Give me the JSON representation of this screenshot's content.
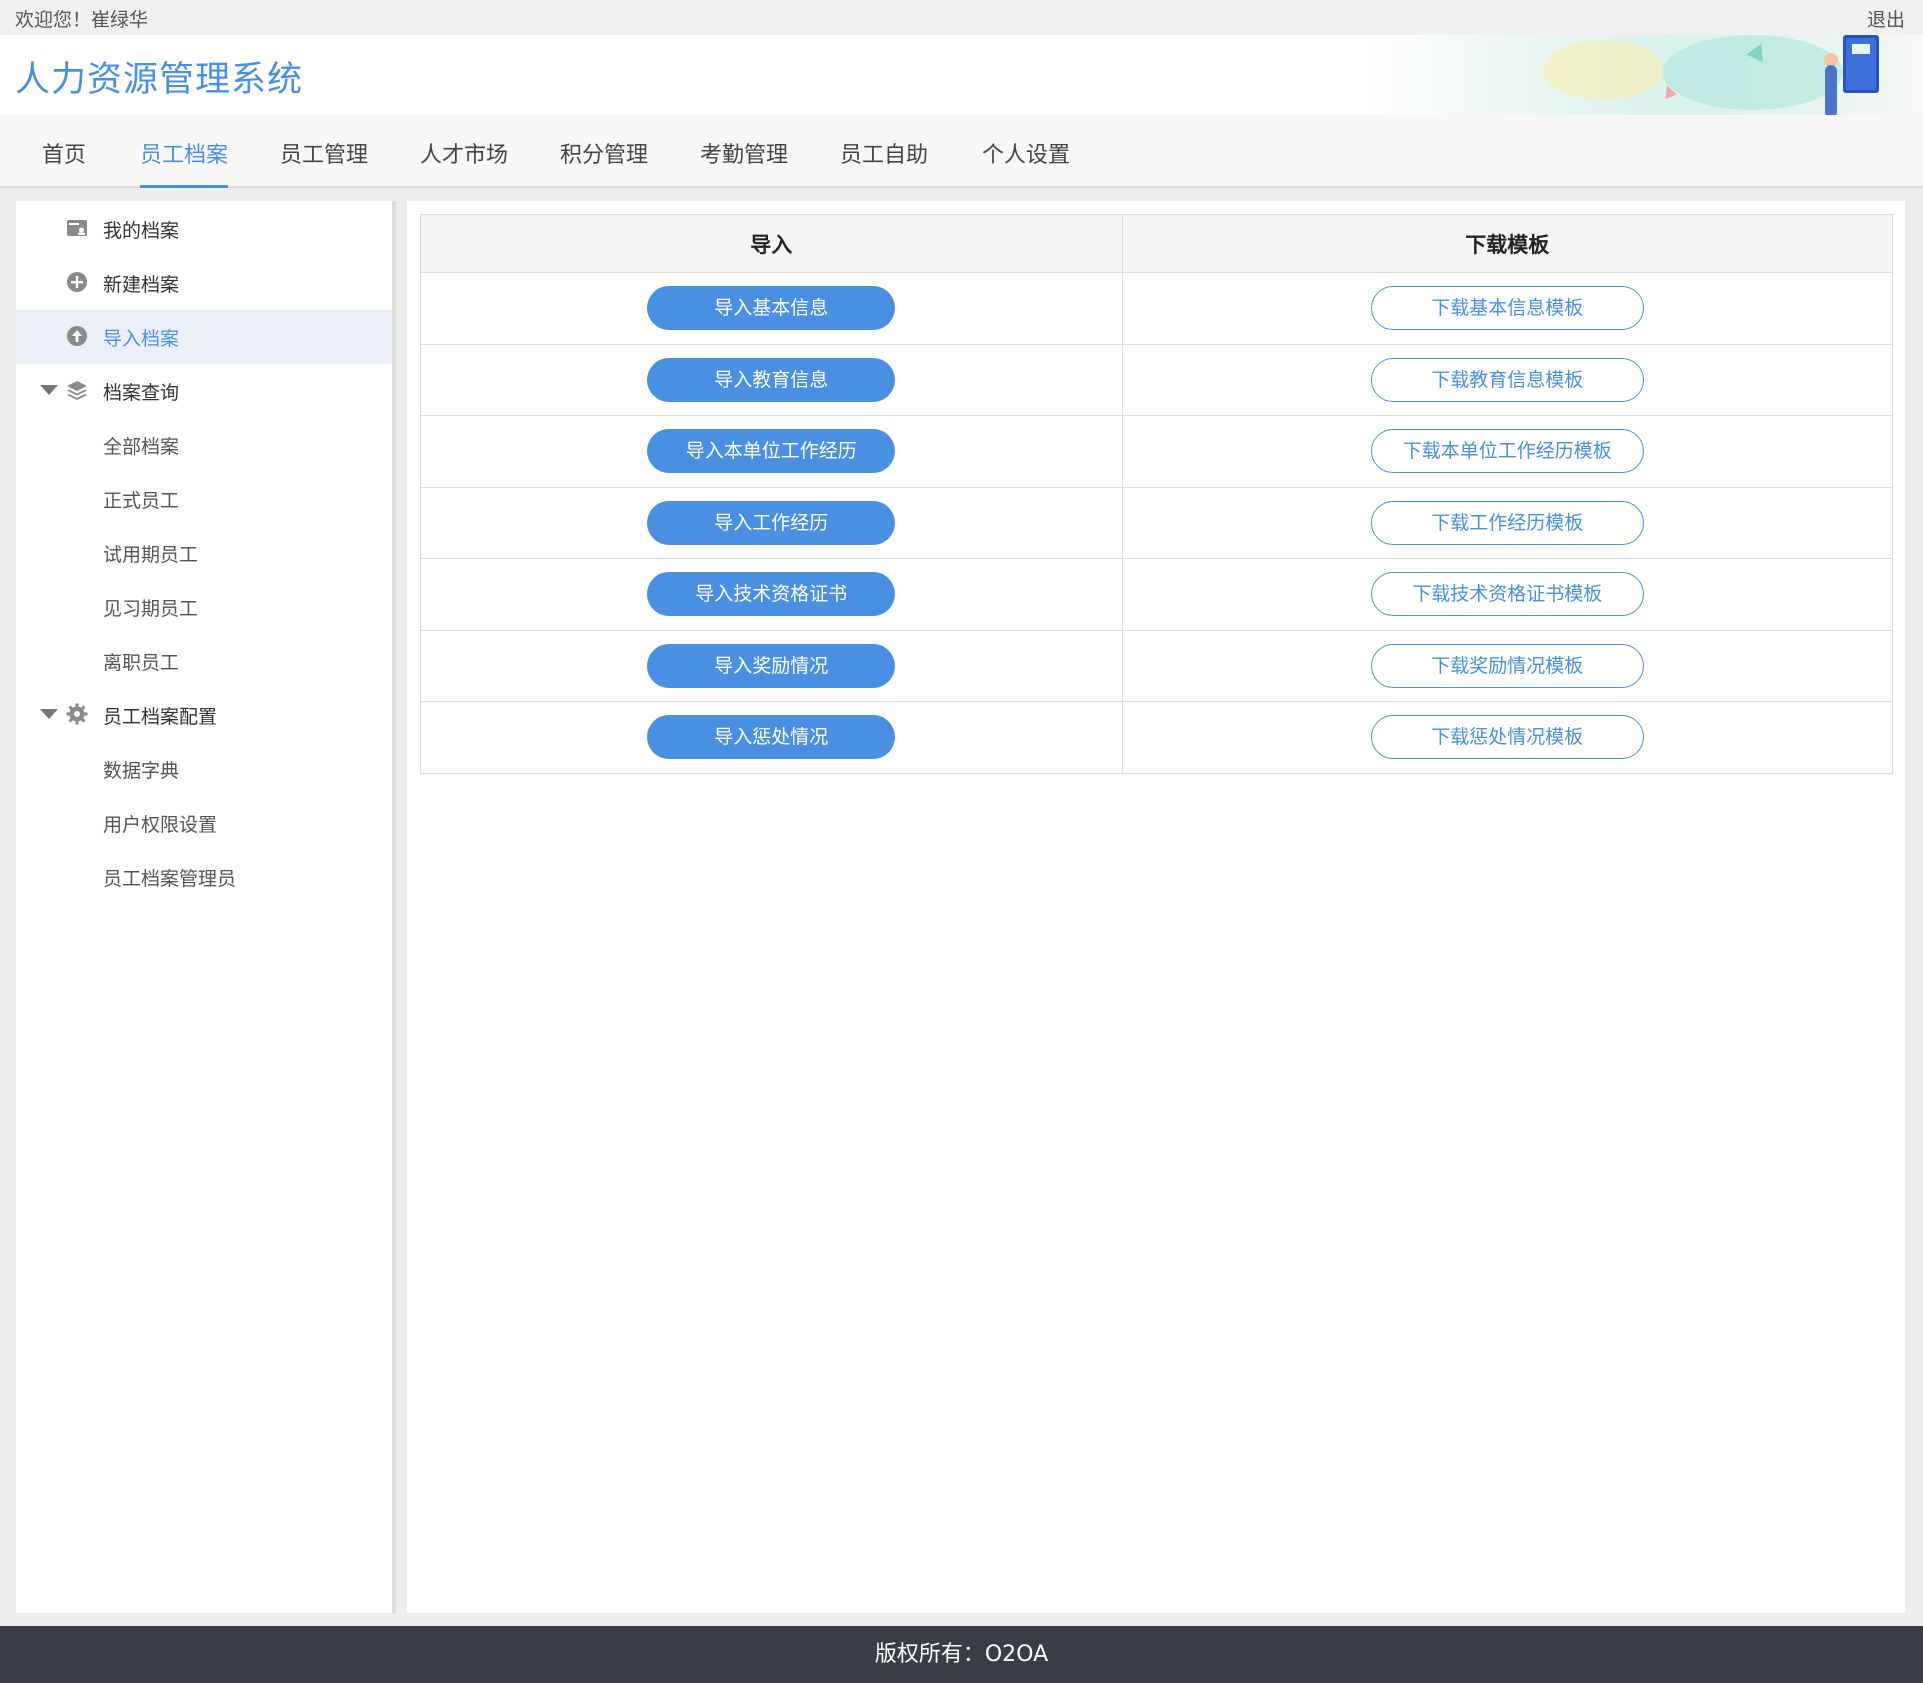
{
  "topbar": {
    "welcome": "欢迎您！崔绿华",
    "logout": "退出"
  },
  "header": {
    "title": "人力资源管理系统"
  },
  "nav": {
    "tabs": [
      {
        "label": "首页"
      },
      {
        "label": "员工档案"
      },
      {
        "label": "员工管理"
      },
      {
        "label": "人才市场"
      },
      {
        "label": "积分管理"
      },
      {
        "label": "考勤管理"
      },
      {
        "label": "员工自助"
      },
      {
        "label": "个人设置"
      }
    ],
    "active": "员工档案"
  },
  "sidebar": {
    "my_archive": "我的档案",
    "new_archive": "新建档案",
    "import_archive": "导入档案",
    "query_group": "档案查询",
    "query_items": [
      "全部档案",
      "正式员工",
      "试用期员工",
      "见习期员工",
      "离职员工"
    ],
    "config_group": "员工档案配置",
    "config_items": [
      "数据字典",
      "用户权限设置",
      "员工档案管理员"
    ],
    "active": "导入档案"
  },
  "table": {
    "headers": {
      "import": "导入",
      "download": "下载模板"
    },
    "rows": [
      {
        "import": "导入基本信息",
        "download": "下载基本信息模板"
      },
      {
        "import": "导入教育信息",
        "download": "下载教育信息模板"
      },
      {
        "import": "导入本单位工作经历",
        "download": "下载本单位工作经历模板"
      },
      {
        "import": "导入工作经历",
        "download": "下载工作经历模板"
      },
      {
        "import": "导入技术资格证书",
        "download": "下载技术资格证书模板"
      },
      {
        "import": "导入奖励情况",
        "download": "下载奖励情况模板"
      },
      {
        "import": "导入惩处情况",
        "download": "下载惩处情况模板"
      }
    ]
  },
  "footer": {
    "copyright": "版权所有：O2OA"
  },
  "colors": {
    "accent": "#4a90e2",
    "footer_bg": "#383d48",
    "active_bg": "#ebf0f8"
  },
  "icons": {
    "my_archive": "archive-card-icon",
    "new_archive": "plus-circle-icon",
    "import_archive": "upload-circle-icon",
    "query_group": "layers-icon",
    "config_group": "gear-icon"
  }
}
